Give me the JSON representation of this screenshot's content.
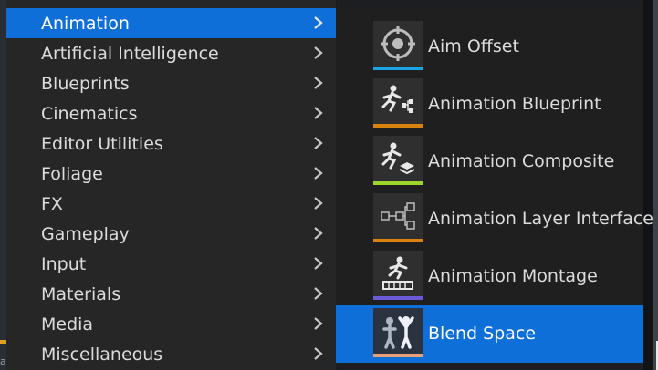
{
  "menu": {
    "items": [
      {
        "label": "Animation",
        "active": true
      },
      {
        "label": "Artificial Intelligence"
      },
      {
        "label": "Blueprints"
      },
      {
        "label": "Cinematics"
      },
      {
        "label": "Editor Utilities"
      },
      {
        "label": "Foliage"
      },
      {
        "label": "FX"
      },
      {
        "label": "Gameplay"
      },
      {
        "label": "Input"
      },
      {
        "label": "Materials"
      },
      {
        "label": "Media"
      },
      {
        "label": "Miscellaneous"
      }
    ]
  },
  "submenu": {
    "items": [
      {
        "label": "Aim Offset",
        "icon": "aim-offset-icon",
        "accent": "#1aa3e8"
      },
      {
        "label": "Animation Blueprint",
        "icon": "animation-blueprint-icon",
        "accent": "#d9820f"
      },
      {
        "label": "Animation Composite",
        "icon": "animation-composite-icon",
        "accent": "#9fd62b"
      },
      {
        "label": "Animation Layer Interface",
        "icon": "animation-layer-interface-icon",
        "accent": "#d9820f"
      },
      {
        "label": "Animation Montage",
        "icon": "animation-montage-icon",
        "accent": "#6a5ad8"
      },
      {
        "label": "Blend Space",
        "icon": "blend-space-icon",
        "accent": "#e8a07a",
        "active": true
      }
    ]
  },
  "colors": {
    "selection": "#0f6fd9",
    "menu_bg": "#262626",
    "submenu_bg": "#1f1f1f",
    "text": "#dcdcdc"
  },
  "background": {
    "partial_glyph": "a"
  }
}
